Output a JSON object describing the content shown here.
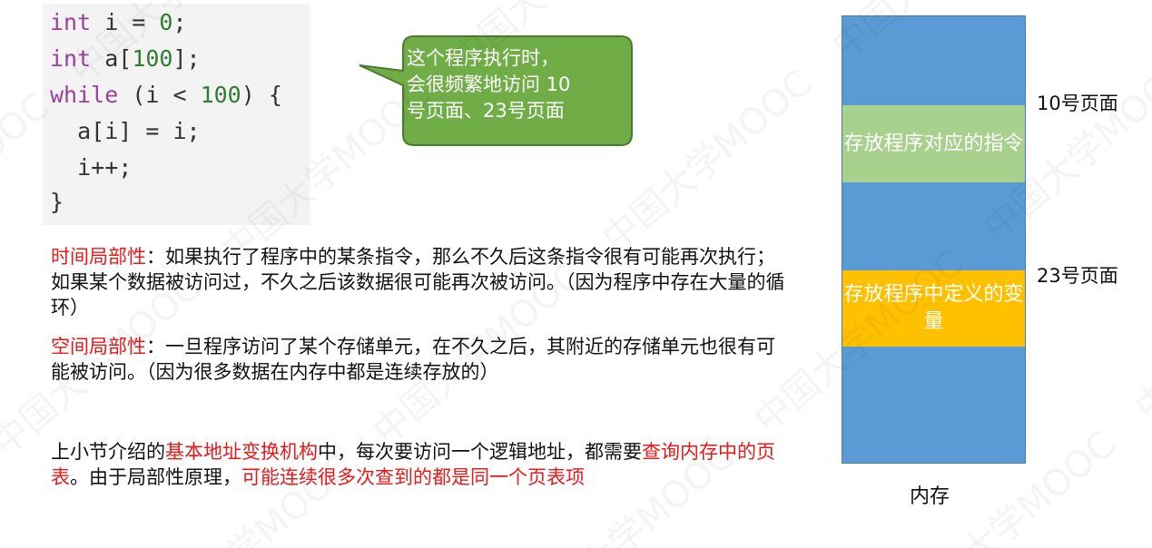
{
  "code": {
    "line1": {
      "kw": "int",
      "mid": " i = ",
      "num": "0",
      "end": ";"
    },
    "line2": {
      "kw": "int",
      "mid": " a[",
      "num": "100",
      "end": "];"
    },
    "line3": {
      "kw": "while",
      "mid": " (i < ",
      "num": "100",
      "end": ") {"
    },
    "line4": "  a[i] = i;",
    "line5": "  i++;",
    "line6": "}"
  },
  "callout": {
    "lines": [
      "这个程序执行时，",
      "会很频繁地访问 10",
      "号页面、23号页面"
    ],
    "fill": "#70ad47"
  },
  "temporal": {
    "term": "时间局部性",
    "rest": "：如果执行了程序中的某条指令，那么不久后这条指令很有可能再次执行；如果某个数据被访问过，不久之后该数据很可能再次被访问。（因为程序中存在大量的循环）"
  },
  "spatial": {
    "term": "空间局部性",
    "rest": "：一旦程序访问了某个存储单元，在不久之后，其附近的存储单元也很有可能被访问。（因为很多数据在内存中都是连续存放的）"
  },
  "summary": {
    "p1": "上小节介绍的",
    "red1": "基本地址变换机构",
    "p2": "中，每次要访问一个逻辑地址，都需要",
    "red2": "查询内存中的页表",
    "p3": "。由于局部性原理，",
    "red3": "可能连续很多次查到的都是同一个页表项"
  },
  "memory": {
    "caption": "内存",
    "block_instructions": "存放程序对应的指令",
    "block_variables": "存放程序中定义的变量",
    "page10_label": "10号页面",
    "page23_label": "23号页面",
    "colors": {
      "memory": "#5b9bd5",
      "instructions": "#a9d18e",
      "variables": "#ffc000"
    }
  },
  "watermark_text": "中国大学MOOC"
}
